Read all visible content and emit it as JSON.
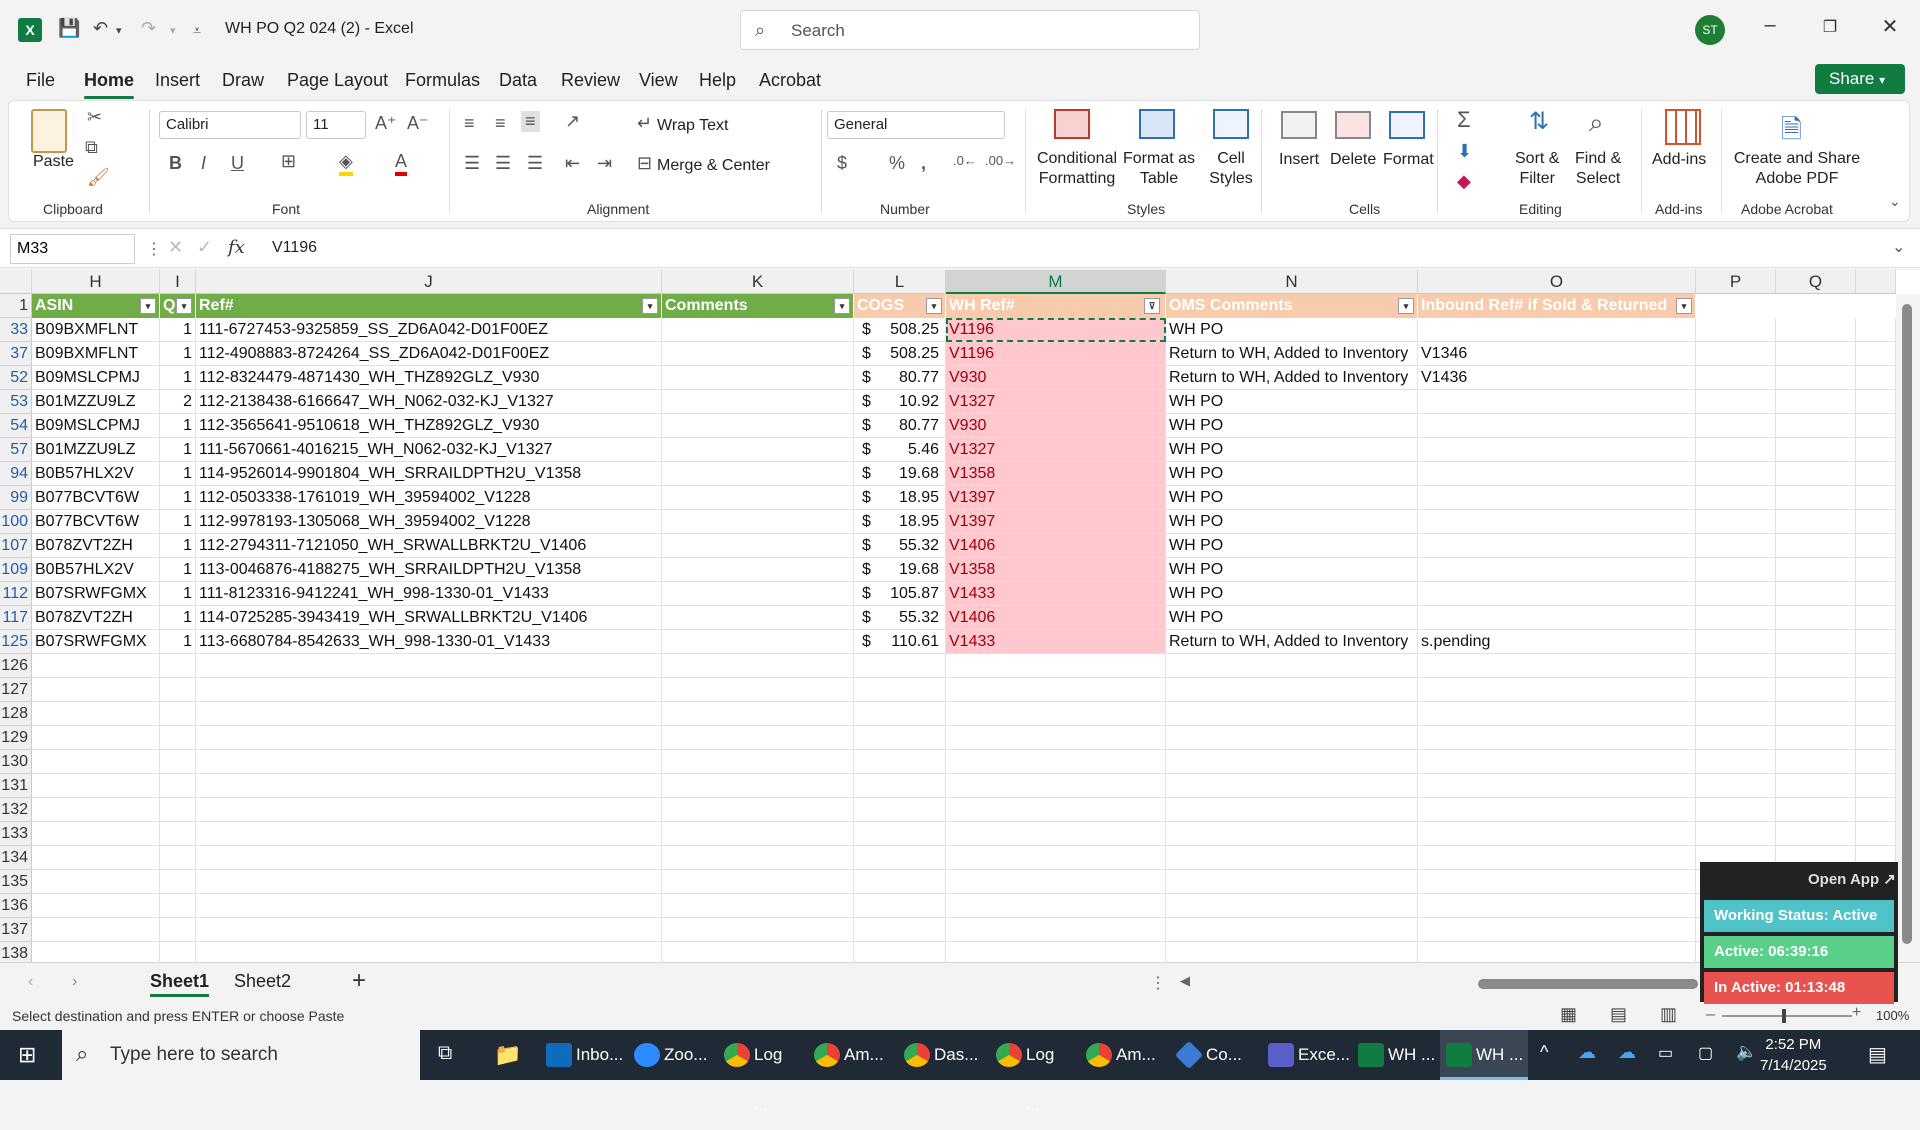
{
  "window": {
    "title": "WH PO Q2 024 (2)  -  Excel",
    "search_placeholder": "Search",
    "user_initials": "ST"
  },
  "ribbon_tabs": [
    "File",
    "Home",
    "Insert",
    "Draw",
    "Page Layout",
    "Formulas",
    "Data",
    "Review",
    "View",
    "Help",
    "Acrobat"
  ],
  "share_label": "Share",
  "ribbon": {
    "clipboard": {
      "paste": "Paste",
      "label": "Clipboard"
    },
    "font": {
      "name": "Calibri",
      "size": "11",
      "label": "Font"
    },
    "alignment": {
      "wrap": "Wrap Text",
      "merge": "Merge & Center",
      "label": "Alignment"
    },
    "number": {
      "format": "General",
      "label": "Number"
    },
    "styles": {
      "conditional": "Conditional\nFormatting",
      "format_table": "Format as\nTable",
      "cell_styles": "Cell\nStyles",
      "label": "Styles"
    },
    "cells": {
      "insert": "Insert",
      "delete": "Delete",
      "format": "Format",
      "label": "Cells"
    },
    "editing": {
      "sort": "Sort &\nFilter",
      "find": "Find &\nSelect",
      "label": "Editing"
    },
    "addins": {
      "addins": "Add-ins",
      "label": "Add-ins"
    },
    "acrobat": {
      "create": "Create and Share\nAdobe PDF",
      "label": "Adobe Acrobat"
    }
  },
  "formula_bar": {
    "name_box": "M33",
    "value": "V1196"
  },
  "columns": [
    "H",
    "I",
    "J",
    "K",
    "L",
    "M",
    "N",
    "O",
    "P",
    "Q"
  ],
  "headers": {
    "asin": "ASIN",
    "q": "Q",
    "ref": "Ref#",
    "comments": "Comments",
    "cogs": "COGS",
    "wh_ref": "WH Ref#",
    "oms": "OMS Comments",
    "inbound": "Inbound Ref# if Sold & Returned"
  },
  "rows": [
    {
      "row": "33",
      "asin": "B09BXMFLNT",
      "q": "1",
      "ref": "111-6727453-9325859_SS_ZD6A042-D01F00EZ",
      "cur": "$",
      "cogs": "508.25",
      "wh": "V1196",
      "oms": "WH PO",
      "inbound": ""
    },
    {
      "row": "37",
      "asin": "B09BXMFLNT",
      "q": "1",
      "ref": "112-4908883-8724264_SS_ZD6A042-D01F00EZ",
      "cur": "$",
      "cogs": "508.25",
      "wh": "V1196",
      "oms": "Return to WH, Added to Inventory",
      "inbound": "V1346"
    },
    {
      "row": "52",
      "asin": "B09MSLCPMJ",
      "q": "1",
      "ref": "112-8324479-4871430_WH_THZ892GLZ_V930",
      "cur": "$",
      "cogs": "80.77",
      "wh": "V930",
      "oms": "Return to WH, Added to Inventory",
      "inbound": "V1436"
    },
    {
      "row": "53",
      "asin": "B01MZZU9LZ",
      "q": "2",
      "ref": "112-2138438-6166647_WH_N062-032-KJ_V1327",
      "cur": "$",
      "cogs": "10.92",
      "wh": "V1327",
      "oms": "WH PO",
      "inbound": ""
    },
    {
      "row": "54",
      "asin": "B09MSLCPMJ",
      "q": "1",
      "ref": "112-3565641-9510618_WH_THZ892GLZ_V930",
      "cur": "$",
      "cogs": "80.77",
      "wh": "V930",
      "oms": "WH PO",
      "inbound": ""
    },
    {
      "row": "57",
      "asin": "B01MZZU9LZ",
      "q": "1",
      "ref": "111-5670661-4016215_WH_N062-032-KJ_V1327",
      "cur": "$",
      "cogs": "5.46",
      "wh": "V1327",
      "oms": "WH PO",
      "inbound": ""
    },
    {
      "row": "94",
      "asin": "B0B57HLX2V",
      "q": "1",
      "ref": "114-9526014-9901804_WH_SRRAILDPTH2U_V1358",
      "cur": "$",
      "cogs": "19.68",
      "wh": "V1358",
      "oms": "WH PO",
      "inbound": ""
    },
    {
      "row": "99",
      "asin": "B077BCVT6W",
      "q": "1",
      "ref": "112-0503338-1761019_WH_39594002_V1228",
      "cur": "$",
      "cogs": "18.95",
      "wh": "V1397",
      "oms": "WH PO",
      "inbound": ""
    },
    {
      "row": "100",
      "asin": "B077BCVT6W",
      "q": "1",
      "ref": "112-9978193-1305068_WH_39594002_V1228",
      "cur": "$",
      "cogs": "18.95",
      "wh": "V1397",
      "oms": "WH PO",
      "inbound": ""
    },
    {
      "row": "107",
      "asin": "B078ZVT2ZH",
      "q": "1",
      "ref": "112-2794311-7121050_WH_SRWALLBRKT2U_V1406",
      "cur": "$",
      "cogs": "55.32",
      "wh": "V1406",
      "oms": "WH PO",
      "inbound": ""
    },
    {
      "row": "109",
      "asin": "B0B57HLX2V",
      "q": "1",
      "ref": "113-0046876-4188275_WH_SRRAILDPTH2U_V1358",
      "cur": "$",
      "cogs": "19.68",
      "wh": "V1358",
      "oms": "WH PO",
      "inbound": ""
    },
    {
      "row": "112",
      "asin": "B07SRWFGMX",
      "q": "1",
      "ref": "111-8123316-9412241_WH_998-1330-01_V1433",
      "cur": "$",
      "cogs": "105.87",
      "wh": "V1433",
      "oms": "WH PO",
      "inbound": ""
    },
    {
      "row": "117",
      "asin": "B078ZVT2ZH",
      "q": "1",
      "ref": "114-0725285-3943419_WH_SRWALLBRKT2U_V1406",
      "cur": "$",
      "cogs": "55.32",
      "wh": "V1406",
      "oms": "WH PO",
      "inbound": ""
    },
    {
      "row": "125",
      "asin": "B07SRWFGMX",
      "q": "1",
      "ref": "113-6680784-8542633_WH_998-1330-01_V1433",
      "cur": "$",
      "cogs": "110.61",
      "wh": "V1433",
      "oms": "Return to WH, Added to Inventory",
      "inbound": "s.pending"
    }
  ],
  "empty_rows": [
    "126",
    "127",
    "128",
    "129",
    "130",
    "131",
    "132",
    "133",
    "134",
    "135",
    "136",
    "137",
    "138"
  ],
  "header_row_number": "1",
  "sheets": [
    "Sheet1",
    "Sheet2"
  ],
  "status": {
    "message": "Select destination and press ENTER or choose Paste",
    "zoom": "100%"
  },
  "widget": {
    "open_app": "Open App ↗",
    "working": "Working Status: Active",
    "active": "Active: 06:39:16",
    "inactive": "In Active: 01:13:48"
  },
  "taskbar": {
    "search_placeholder": "Type here to search",
    "apps": [
      "Inbo...",
      "Zoo...",
      "Log ...",
      "Am...",
      "Das...",
      "Log ...",
      "Am...",
      "Co...",
      "Exce...",
      "WH ...",
      "WH ..."
    ],
    "time": "2:52 PM",
    "date": "7/14/2025"
  },
  "colors": {
    "excel_green": "#107c41",
    "header_green": "#70ad47",
    "header_orange": "#f8cbad",
    "highlight_pink": "#ffc7ce",
    "taskbar": "#202a36"
  }
}
